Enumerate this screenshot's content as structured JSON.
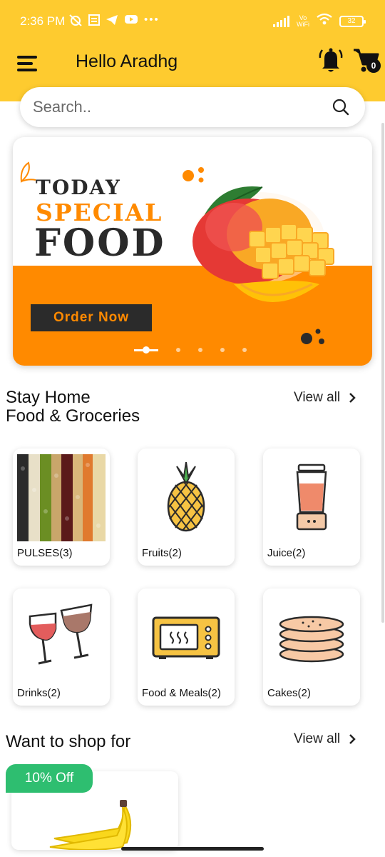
{
  "status_bar": {
    "time": "2:36 PM",
    "left_icons": [
      "alarm-off-icon",
      "news-icon",
      "telegram-icon",
      "youtube-icon",
      "more-dots-icon"
    ],
    "network_label": "Vo WiFi",
    "battery": "32"
  },
  "app_bar": {
    "greeting": "Hello Aradhg",
    "cart_count": "0"
  },
  "search": {
    "placeholder": "Search.."
  },
  "banner": {
    "line1": "TODAY",
    "line2": "SPECIAL",
    "line3": "FOOD",
    "button": "Order Now",
    "slides": 5,
    "active_slide": 1
  },
  "section1": {
    "title_line1": "Stay Home",
    "title_line2": "Food & Groceries",
    "view_all": "View all"
  },
  "categories": [
    {
      "label": "PULSES(3)"
    },
    {
      "label": "Fruits(2)"
    },
    {
      "label": "Juice(2)"
    },
    {
      "label": "Drinks(2)"
    },
    {
      "label": "Food & Meals(2)"
    },
    {
      "label": "Cakes(2)"
    }
  ],
  "section2": {
    "title": "Want to shop for",
    "view_all": "View all"
  },
  "product": {
    "discount": "10% Off"
  },
  "colors": {
    "brand_yellow": "#FECB2F",
    "banner_orange": "#FF8A00",
    "discount_green": "#2EBE70"
  }
}
